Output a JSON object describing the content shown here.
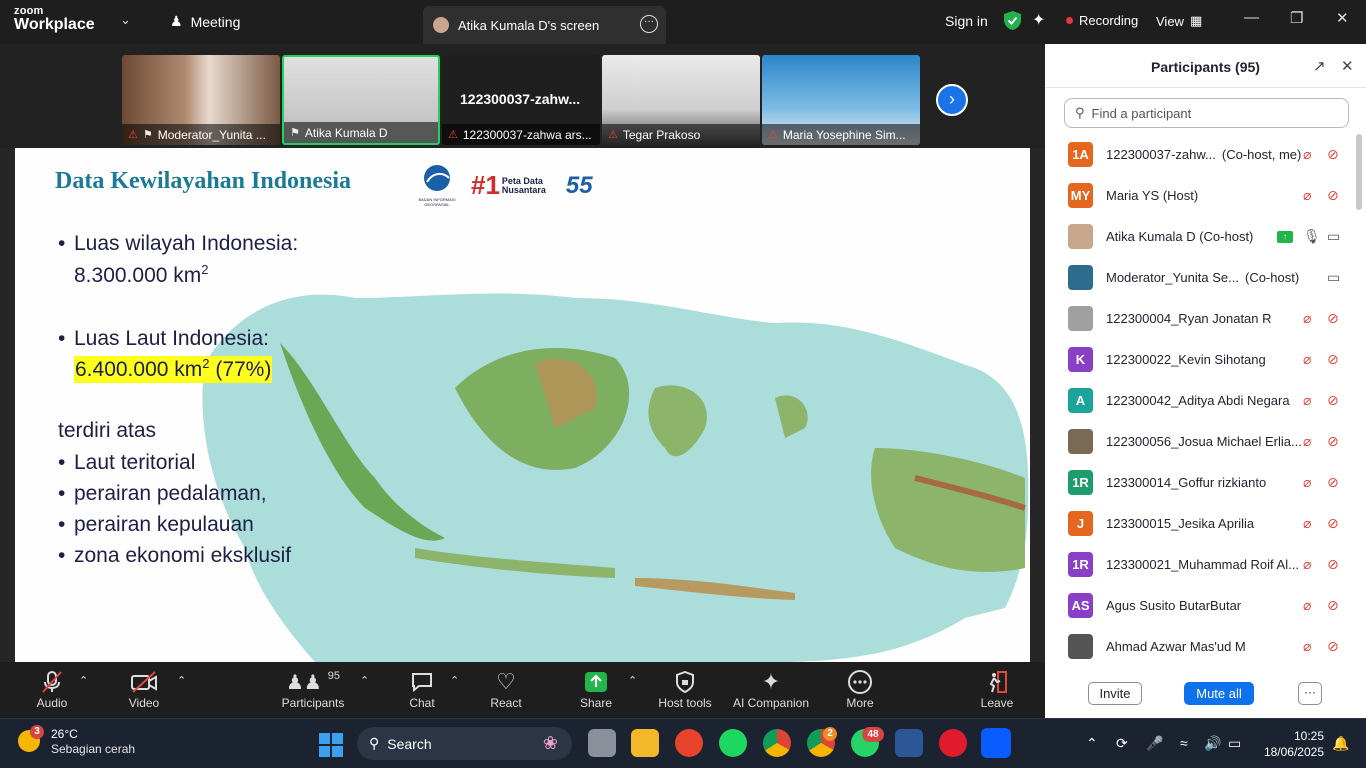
{
  "titlebar": {
    "brand_small": "zoom",
    "brand_big": "Workplace",
    "meeting_label": "Meeting",
    "screen_tab": "Atika Kumala D's screen",
    "signin": "Sign in",
    "recording": "Recording",
    "view": "View"
  },
  "videos": [
    {
      "name": "Moderator_Yunita ...",
      "bg": "#8a6a55"
    },
    {
      "name": "Atika Kumala D",
      "bg": "#c8c8c8"
    },
    {
      "name": "122300037-zahwa ars...",
      "bg": "#1f1f1f",
      "title": "122300037-zahw..."
    },
    {
      "name": "Tegar Prakoso",
      "bg": "#cfcfcf"
    },
    {
      "name": "Maria Yosephine Sim...",
      "bg": "#2c86c9"
    }
  ],
  "slide": {
    "title": "Data Kewilayahan Indonesia",
    "logo2_num": "#1",
    "logo2_text": "Peta Data Nusantara",
    "logo1_text": "BADAN INFORMASI GEOSPASIAL",
    "logo3_text": "55",
    "b1_a": "Luas wilayah Indonesia:",
    "b1_b": "8.300.000 km",
    "b2_a": "Luas Laut Indonesia:",
    "b2_b": "6.400.000 km",
    "b2_c": " (77%)",
    "sup": "2",
    "terdiri": "terdiri atas",
    "list": [
      "Laut teritorial",
      "perairan pedalaman,",
      "perairan kepulauan",
      "zona ekonomi eksklusif"
    ]
  },
  "toolbar": {
    "audio": "Audio",
    "video": "Video",
    "participants": "Participants",
    "participants_count": "95",
    "chat": "Chat",
    "react": "React",
    "share": "Share",
    "host_tools": "Host tools",
    "ai": "AI Companion",
    "more": "More",
    "leave": "Leave"
  },
  "panel": {
    "title": "Participants (95)",
    "search_placeholder": "Find a participant",
    "invite": "Invite",
    "mute_all": "Mute all",
    "more": "···",
    "participants": [
      {
        "initials": "1A",
        "color": "#e5661e",
        "name": "122300037-zahw...",
        "role": "(Co-host, me)"
      },
      {
        "initials": "MY",
        "color": "#e5661e",
        "name": "Maria YS (Host)",
        "role": ""
      },
      {
        "initials": "",
        "color": "#c9a78f",
        "name": "Atika Kumala D (Co-host)",
        "role": ""
      },
      {
        "initials": "",
        "color": "#2e6c8f",
        "name": "Moderator_Yunita Se...",
        "role": "(Co-host)"
      },
      {
        "initials": "",
        "color": "#a0a0a0",
        "name": "122300004_Ryan Jonatan R",
        "role": ""
      },
      {
        "initials": "K",
        "color": "#8a3fc7",
        "name": "122300022_Kevin Sihotang",
        "role": ""
      },
      {
        "initials": "A",
        "color": "#1ba39c",
        "name": "122300042_Aditya Abdi Negara",
        "role": ""
      },
      {
        "initials": "",
        "color": "#7a6a55",
        "name": "122300056_Josua Michael Erlia...",
        "role": ""
      },
      {
        "initials": "1R",
        "color": "#1f9c6b",
        "name": "123300014_Goffur rizkianto",
        "role": ""
      },
      {
        "initials": "J",
        "color": "#e5661e",
        "name": "123300015_Jesika Aprilia",
        "role": ""
      },
      {
        "initials": "1R",
        "color": "#8a3fc7",
        "name": "123300021_Muhammad Roif Al...",
        "role": ""
      },
      {
        "initials": "AS",
        "color": "#8a3fc7",
        "name": "Agus Susito ButarButar",
        "role": ""
      },
      {
        "initials": "",
        "color": "#555",
        "name": "Ahmad Azwar Mas'ud M",
        "role": ""
      }
    ]
  },
  "taskbar": {
    "weather_badge": "3",
    "temp": "26°C",
    "condition": "Sebagian cerah",
    "search": "Search",
    "chrome2_badge": "2",
    "whatsapp_badge": "48",
    "time": "10:25",
    "date": "18/06/2025"
  }
}
